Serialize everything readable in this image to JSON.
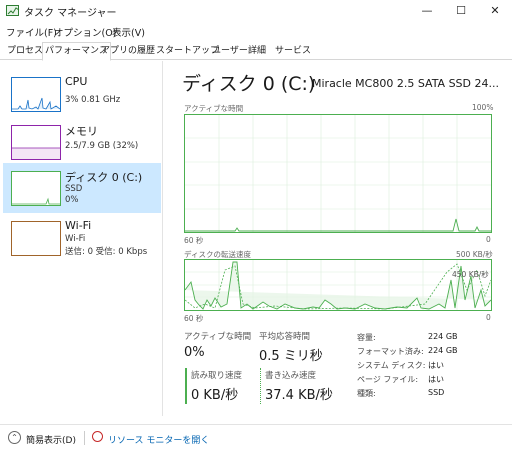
{
  "window": {
    "title": "タスク マネージャー",
    "minimize": "—",
    "maximize": "☐",
    "close": "✕"
  },
  "menu": [
    "ファイル(F)",
    "オプション(O)",
    "表示(V)"
  ],
  "tabs": [
    "プロセス",
    "パフォーマンス",
    "アプリの履歴",
    "スタートアップ",
    "ユーザー",
    "詳細",
    "サービス"
  ],
  "active_tab": "パフォーマンス",
  "sidebar": [
    {
      "name": "CPU",
      "sub1": "3%  0.81 GHz",
      "sub2": "",
      "color": "#1a73c8"
    },
    {
      "name": "メモリ",
      "sub1": "2.5/7.9 GB (32%)",
      "sub2": "",
      "color": "#8e24aa"
    },
    {
      "name": "ディスク 0 (C:)",
      "sub1": "SSD",
      "sub2": "0%",
      "color": "#4caf50"
    },
    {
      "name": "Wi-Fi",
      "sub1": "Wi-Fi",
      "sub2": "送信: 0 受信: 0 Kbps",
      "color": "#a0642a"
    }
  ],
  "disk": {
    "title": "ディスク 0 (C:)",
    "model": "Miracle MC800 2.5 SATA SSD 24...",
    "graph1": {
      "label": "アクティブな時間",
      "max_label": "100%",
      "time_label": "60 秒",
      "min_label": "0"
    },
    "graph2": {
      "label": "ディスクの転送速度",
      "max_label": "500 KB/秒",
      "mid_label": "450 KB/秒",
      "time_label": "60 秒",
      "min_label": "0"
    },
    "stats": {
      "active_label": "アクティブな時間",
      "active_value": "0%",
      "response_label": "平均応答時間",
      "response_value": "0.5 ミリ秒",
      "read_label": "読み取り速度",
      "read_value": "0 KB/秒",
      "write_label": "書き込み速度",
      "write_value": "37.4 KB/秒"
    },
    "properties": [
      {
        "key": "容量:",
        "value": "224 GB"
      },
      {
        "key": "フォーマット済み:",
        "value": "224 GB"
      },
      {
        "key": "システム ディスク:",
        "value": "はい"
      },
      {
        "key": "ページ ファイル:",
        "value": "はい"
      },
      {
        "key": "種類:",
        "value": "SSD"
      }
    ]
  },
  "bottom": {
    "simple_view": "簡易表示(D)",
    "resource_monitor": "リソース モニターを開く"
  },
  "colors": {
    "disk_green": "#4caf50",
    "selected_bg": "#cce8ff",
    "link": "#0063b1"
  }
}
